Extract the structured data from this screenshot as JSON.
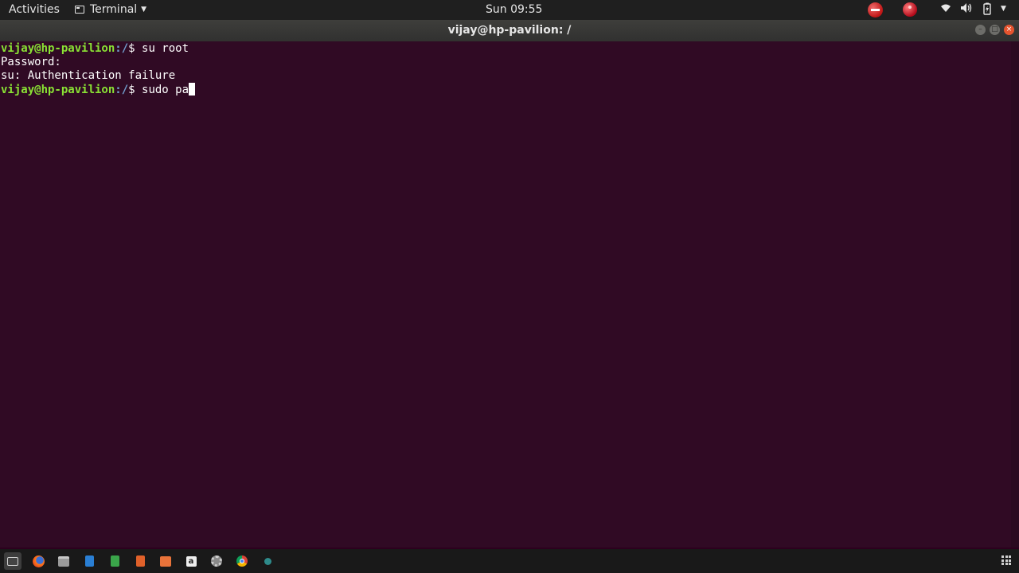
{
  "topbar": {
    "activities": "Activities",
    "app_menu_label": "Terminal",
    "clock": "Sun 09:55",
    "tray_icons": [
      "no-entry-icon",
      "record-icon",
      "wifi-icon",
      "volume-icon",
      "battery-icon",
      "system-menu-caret-icon"
    ]
  },
  "window": {
    "title": "vijay@hp-pavilion: /"
  },
  "terminal": {
    "line1": {
      "prompt": "vijay@hp-pavilion",
      "path": ":/",
      "dollar": "$ ",
      "text": "su root"
    },
    "line2": {
      "text": "Password:"
    },
    "line3": {
      "text": "su: Authentication failure"
    },
    "line4": {
      "prompt": "vijay@hp-pavilion",
      "path": ":/",
      "dollar": "$ ",
      "text": "sudo pa"
    }
  },
  "dock": {
    "items": [
      "terminal-icon",
      "firefox-icon",
      "files-icon",
      "writer-icon",
      "calc-icon",
      "impress-icon",
      "software-center-icon",
      "amazon-icon",
      "settings-icon",
      "chrome-icon",
      "app-icon"
    ]
  },
  "colors": {
    "terminal_bg": "#300a24",
    "prompt_user": "#8ae234",
    "prompt_path": "#729fcf"
  }
}
